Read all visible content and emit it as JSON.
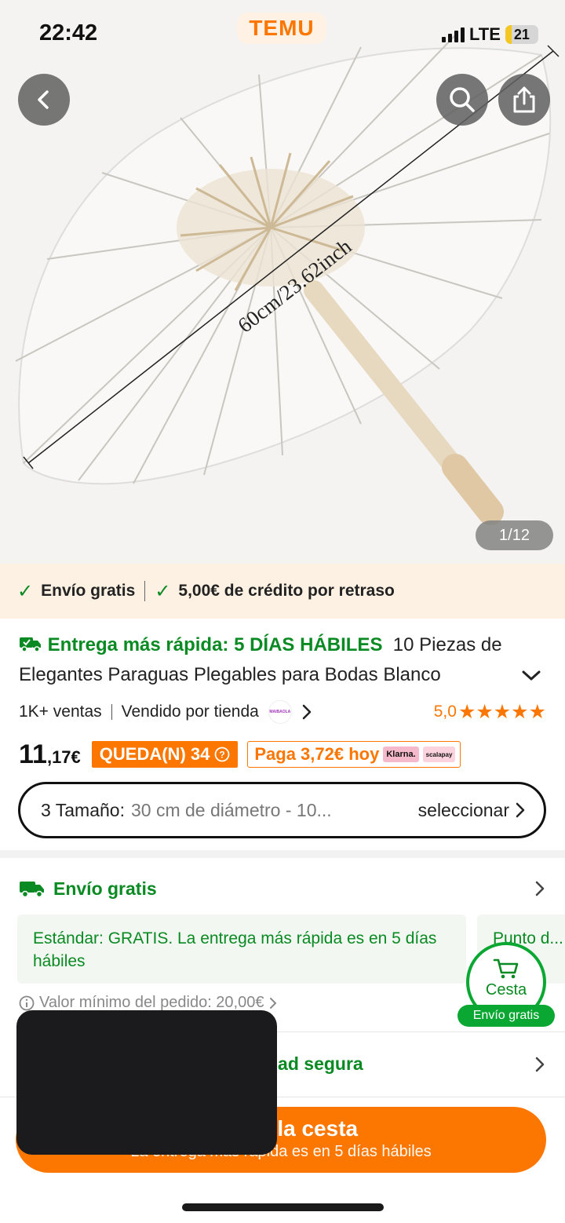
{
  "status_bar": {
    "time": "22:42",
    "network": "LTE",
    "battery": "21"
  },
  "brand": "TEMU",
  "hero": {
    "dimension_label": "60cm/23.62inch",
    "counter": "1/12"
  },
  "promo_strip": {
    "item1": "Envío gratis",
    "item2": "5,00€ de crédito por retraso"
  },
  "product": {
    "delivery_highlight": "Entrega más rápida: 5 DÍAS HÁBILES",
    "title": "10 Piezas de Elegantes Paraguas Plegables para Bodas Blanco",
    "sales": "1K+ ventas",
    "sold_by": "Vendido por tienda",
    "store_logo_text": "MAIBAOLA",
    "rating": "5,0",
    "price_main": "11",
    "price_small": ",17€",
    "stock_badge": "QUEDA(N) 34",
    "pay_today": "Paga 3,72€ hoy",
    "pay_providers": [
      "Klarna.",
      "scalapay"
    ]
  },
  "size_selector": {
    "label": "3 Tamaño:",
    "value": "30 cm de diámetro - 10...",
    "action": "seleccionar"
  },
  "shipping": {
    "header": "Envío gratis",
    "card1": "Estándar: GRATIS. La entrega más rápida es en 5 días hábiles",
    "card2": "Punto d... a e...",
    "min_order": "Valor mínimo del pedido: 20,00€"
  },
  "security": {
    "label": "dad segura"
  },
  "cart_float": {
    "label": "Cesta",
    "pill": "Envío gratis"
  },
  "cta": {
    "main": "a la cesta",
    "sub": "La entrega más rápida es en 5 días hábiles"
  },
  "colors": {
    "accent": "#fb7701",
    "green": "#0a8a22",
    "promo_bg": "#fdf1e4"
  }
}
